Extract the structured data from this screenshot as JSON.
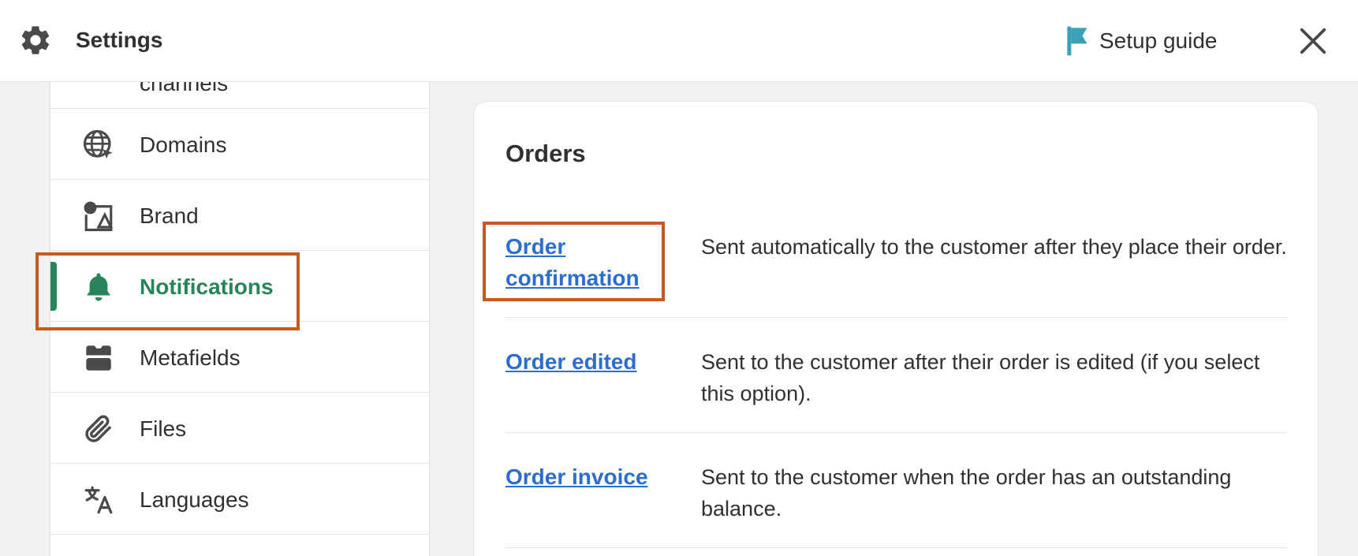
{
  "header": {
    "title": "Settings",
    "setup_guide_label": "Setup guide",
    "icons": {
      "settings": "gear-icon",
      "setup": "flag-icon",
      "close": "close-icon"
    }
  },
  "sidebar": {
    "partial_item_label": "channels",
    "items": [
      {
        "label": "Domains",
        "icon": "globe-icon"
      },
      {
        "label": "Brand",
        "icon": "brand-icon"
      },
      {
        "label": "Notifications",
        "icon": "bell-icon",
        "active": true
      },
      {
        "label": "Metafields",
        "icon": "metafields-icon"
      },
      {
        "label": "Files",
        "icon": "paperclip-icon"
      },
      {
        "label": "Languages",
        "icon": "translate-icon"
      }
    ]
  },
  "main": {
    "section_title": "Orders",
    "notifications": [
      {
        "name": "Order confirmation",
        "description": "Sent automatically to the customer after they place their order."
      },
      {
        "name": "Order edited",
        "description": "Sent to the customer after their order is edited (if you select this option)."
      },
      {
        "name": "Order invoice",
        "description": "Sent to the customer when the order has an outstanding balance."
      }
    ]
  },
  "colors": {
    "accent_green": "#29845a",
    "link_blue": "#2c6ecb",
    "highlight_orange": "#c65a22",
    "flag_teal": "#3aa0b8"
  }
}
